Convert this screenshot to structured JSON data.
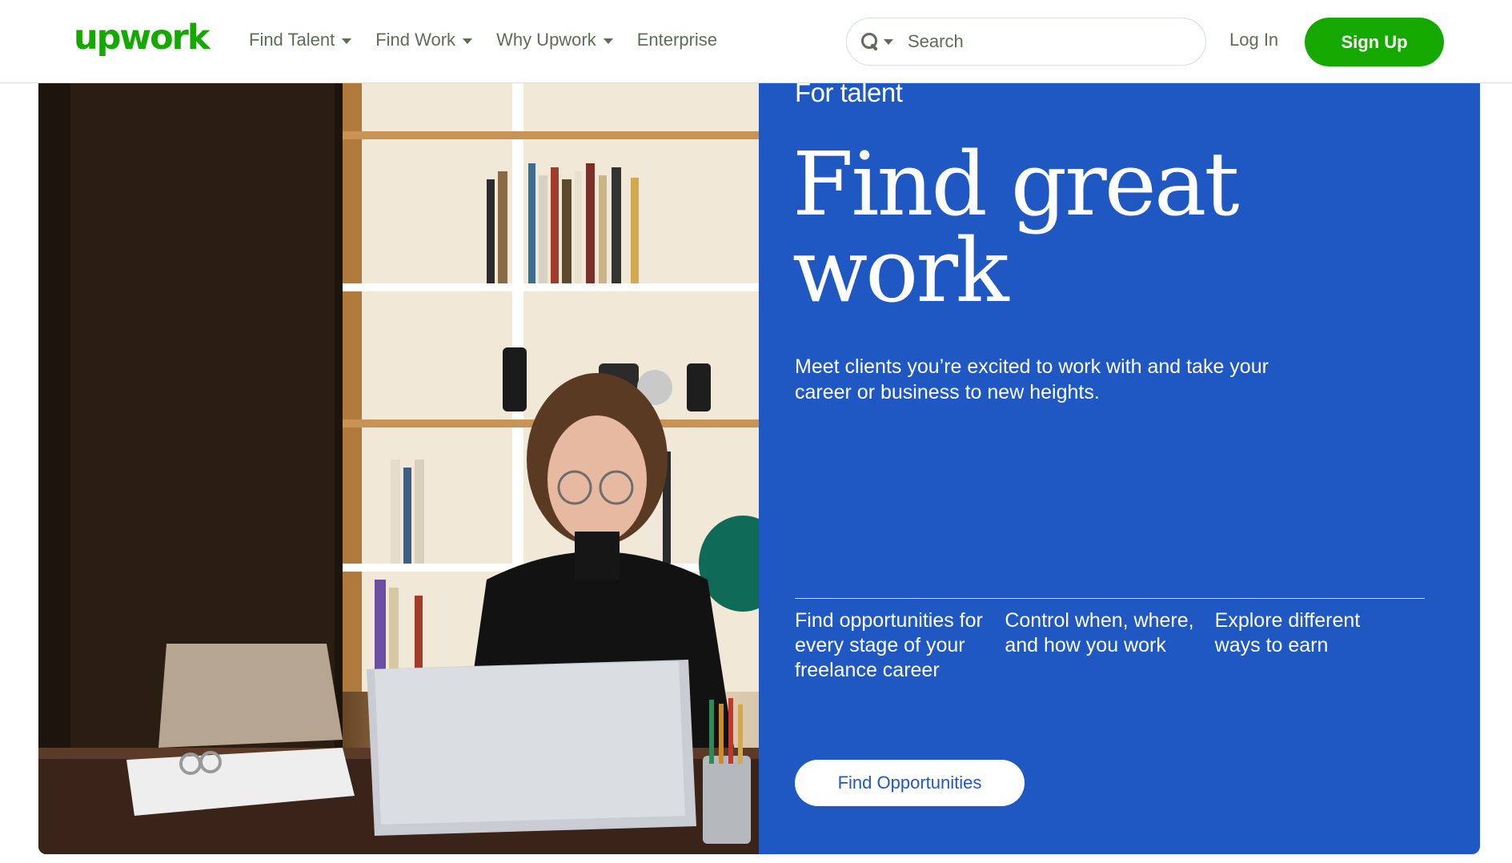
{
  "header": {
    "logo": "upwork",
    "nav": [
      {
        "label": "Find Talent",
        "has_dropdown": true
      },
      {
        "label": "Find Work",
        "has_dropdown": true
      },
      {
        "label": "Why Upwork",
        "has_dropdown": true
      },
      {
        "label": "Enterprise",
        "has_dropdown": false
      }
    ],
    "search": {
      "placeholder": "Search",
      "value": ""
    },
    "login_label": "Log In",
    "signup_label": "Sign Up"
  },
  "hero": {
    "eyebrow": "For talent",
    "headline": "Find great work",
    "subtext": "Meet clients you’re excited to work with and take your career or business to new heights.",
    "features": [
      "Find opportunities for every stage of your freelance career",
      "Control when, where, and how you work",
      "Explore different ways to earn"
    ],
    "cta_label": "Find Opportunities"
  },
  "colors": {
    "brand_green": "#14a800",
    "hero_blue": "#1f57c3",
    "nav_text": "#5e6d55",
    "white": "#ffffff"
  },
  "icons": [
    "search-icon",
    "chevron-down-icon"
  ]
}
